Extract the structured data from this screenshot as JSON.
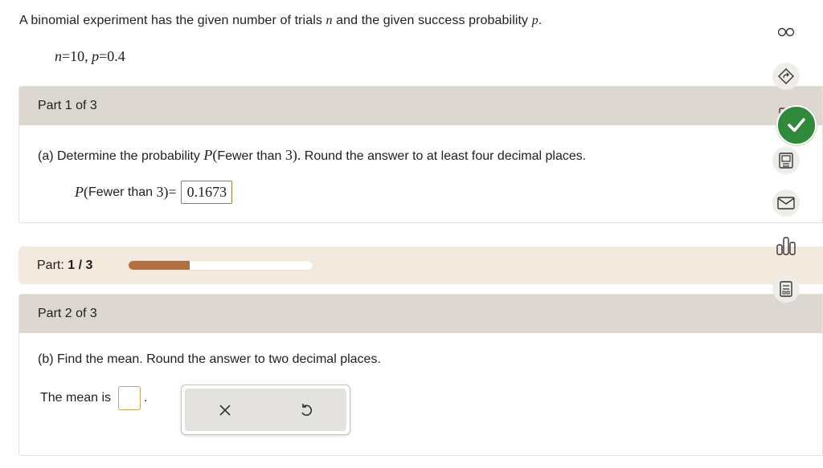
{
  "problem": {
    "intro_before_n": "A binomial experiment has the given number of trials",
    "n_var": "n",
    "intro_mid": "and the given success probability",
    "p_var": "p",
    "intro_end": "."
  },
  "params": {
    "n_var": "n",
    "n_eq": "=10,",
    "p_var": "p",
    "p_eq": "=0.4"
  },
  "part1": {
    "header": "Part 1 of 3",
    "question_prefix": "(a) Determine the probability",
    "question_p": "P",
    "question_open": "(",
    "question_event": "Fewer than",
    "question_num": "3",
    "question_close": ").",
    "question_suffix": "Round the answer to at least four decimal places.",
    "answer_p": "P",
    "answer_open": "(",
    "answer_event": "Fewer than",
    "answer_num": "3",
    "answer_close": ")",
    "answer_eq": "=",
    "answer_value": "0.1673"
  },
  "progress": {
    "label": "Part:",
    "current": "1",
    "sep": "/",
    "total": "3",
    "fraction": 0.333
  },
  "part2": {
    "header": "Part 2 of 3",
    "question": "(b) Find the mean. Round the answer to two decimal places.",
    "mean_label": "The mean is",
    "mean_value": "",
    "mean_period": "."
  },
  "keypad": {
    "clear_icon": "x-icon",
    "undo_icon": "undo-icon"
  },
  "toolbar": {
    "icons": [
      "glasses-icon",
      "tag-arrow-icon",
      "calculator-icon",
      "video-lecture-icon",
      "mail-icon",
      "bar-chart-icon",
      "gradebook-icon"
    ],
    "check_icon": "checkmark-icon",
    "check_color": "#2f8a3a"
  },
  "colors": {
    "header_bg": "#dcd8d1",
    "progress_bg": "#f3e9dd",
    "progress_fill": "#b27040",
    "answer_border": "#9b7e3e"
  }
}
